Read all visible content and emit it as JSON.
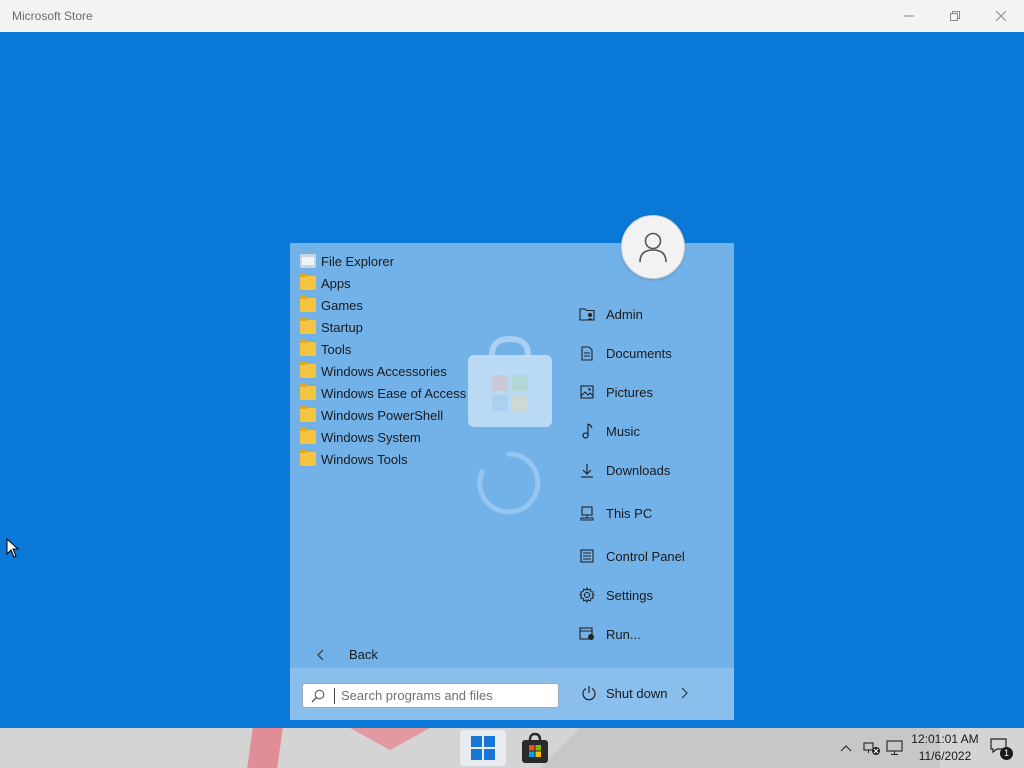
{
  "window": {
    "title": "Microsoft Store"
  },
  "start_menu": {
    "programs": [
      {
        "label": "File Explorer",
        "icon": "file-explorer-icon"
      },
      {
        "label": "Apps",
        "icon": "folder-icon"
      },
      {
        "label": "Games",
        "icon": "folder-icon"
      },
      {
        "label": "Startup",
        "icon": "folder-icon"
      },
      {
        "label": "Tools",
        "icon": "folder-icon"
      },
      {
        "label": "Windows Accessories",
        "icon": "folder-icon"
      },
      {
        "label": "Windows Ease of Access",
        "icon": "folder-icon"
      },
      {
        "label": "Windows PowerShell",
        "icon": "folder-icon"
      },
      {
        "label": "Windows System",
        "icon": "folder-icon"
      },
      {
        "label": "Windows Tools",
        "icon": "folder-icon"
      }
    ],
    "back_label": "Back",
    "places": [
      {
        "label": "Admin",
        "icon": "user-folder-icon"
      },
      {
        "label": "Documents",
        "icon": "document-icon"
      },
      {
        "label": "Pictures",
        "icon": "picture-icon"
      },
      {
        "label": "Music",
        "icon": "music-note-icon"
      },
      {
        "label": "Downloads",
        "icon": "download-icon"
      },
      {
        "label": "This PC",
        "icon": "computer-icon"
      },
      {
        "label": "Control Panel",
        "icon": "control-panel-icon"
      },
      {
        "label": "Settings",
        "icon": "gear-icon"
      },
      {
        "label": "Run...",
        "icon": "run-icon"
      }
    ],
    "search_placeholder": "Search programs and files",
    "shutdown_label": "Shut down"
  },
  "taskbar": {
    "clock_time": "12:01:01 AM",
    "clock_date": "11/6/2022",
    "notification_count": "1"
  },
  "colors": {
    "desktop": "#0a78d7",
    "taskbar": "#d4d4d4",
    "titlebar": "#f3f3f3"
  }
}
